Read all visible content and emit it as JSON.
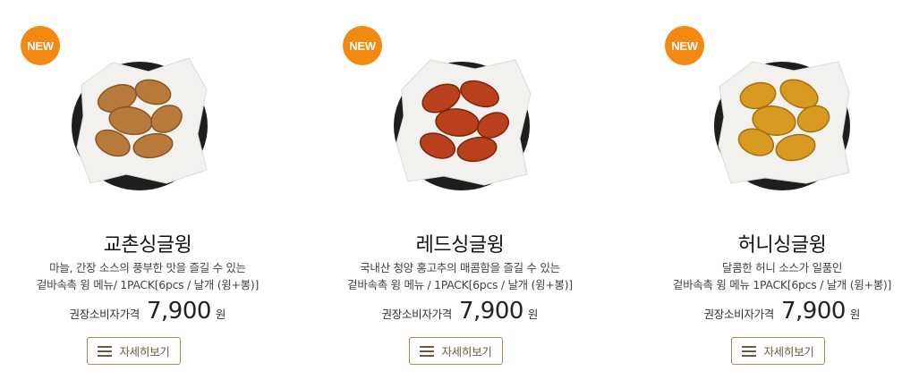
{
  "products": [
    {
      "badge": "NEW",
      "name": "교촌싱글윙",
      "desc_line1": "마늘, 간장 소스의 풍부한 맛을 즐길 수 있는",
      "desc_line2": "겉바속촉 윙 메뉴/ 1PACK[6pcs / 날개 (윙+봉)]",
      "price_label": "권장소비자가격",
      "price": "7,900",
      "price_unit": "원",
      "button_label": "자세히보기",
      "color": "#b87a3a"
    },
    {
      "badge": "NEW",
      "name": "레드싱글윙",
      "desc_line1": "국내산 청양 홍고추의 매콤함을 즐길 수 있는",
      "desc_line2": "겉바속촉 윙 메뉴 / 1PACK[6pcs / 날개 (윙+봉)]",
      "price_label": "권장소비자가격",
      "price": "7,900",
      "price_unit": "원",
      "button_label": "자세히보기",
      "color": "#b8401c"
    },
    {
      "badge": "NEW",
      "name": "허니싱글윙",
      "desc_line1": "달콤한 허니 소스가 일품인",
      "desc_line2": "겉바속촉 윙 메뉴 1PACK[6pcs / 날개 (윙+봉)]",
      "price_label": "권장소비자가격",
      "price": "7,900",
      "price_unit": "원",
      "button_label": "자세히보기",
      "color": "#d99a22"
    }
  ]
}
